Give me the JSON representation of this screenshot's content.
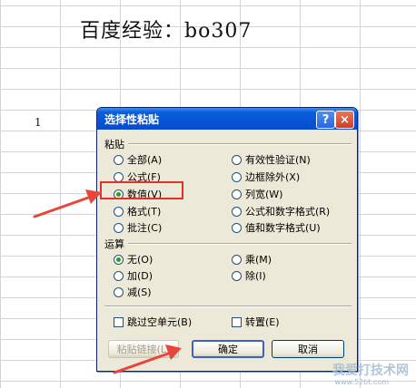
{
  "header_text": "百度经验：bo307",
  "cell_value": "1",
  "dialog": {
    "title": "选择性粘贴",
    "help_glyph": "?",
    "close_glyph": "×",
    "paste_section": "粘贴",
    "paste_options_left": [
      "全部(A)",
      "公式(F)",
      "数值(V)",
      "格式(T)",
      "批注(C)"
    ],
    "paste_options_right": [
      "有效性验证(N)",
      "边框除外(X)",
      "列宽(W)",
      "公式和数字格式(R)",
      "值和数字格式(U)"
    ],
    "operation_section": "运算",
    "operation_left": [
      "无(O)",
      "加(D)",
      "减(S)"
    ],
    "operation_right": [
      "乘(M)",
      "除(I)"
    ],
    "skip_blanks": "跳过空单元(B)",
    "transpose": "转置(E)",
    "paste_link_button": "粘贴链接(L)",
    "ok_button": "确定",
    "cancel_button": "取消"
  },
  "site_brand": "我爱打技术网",
  "site_url": "www.52bt.com"
}
